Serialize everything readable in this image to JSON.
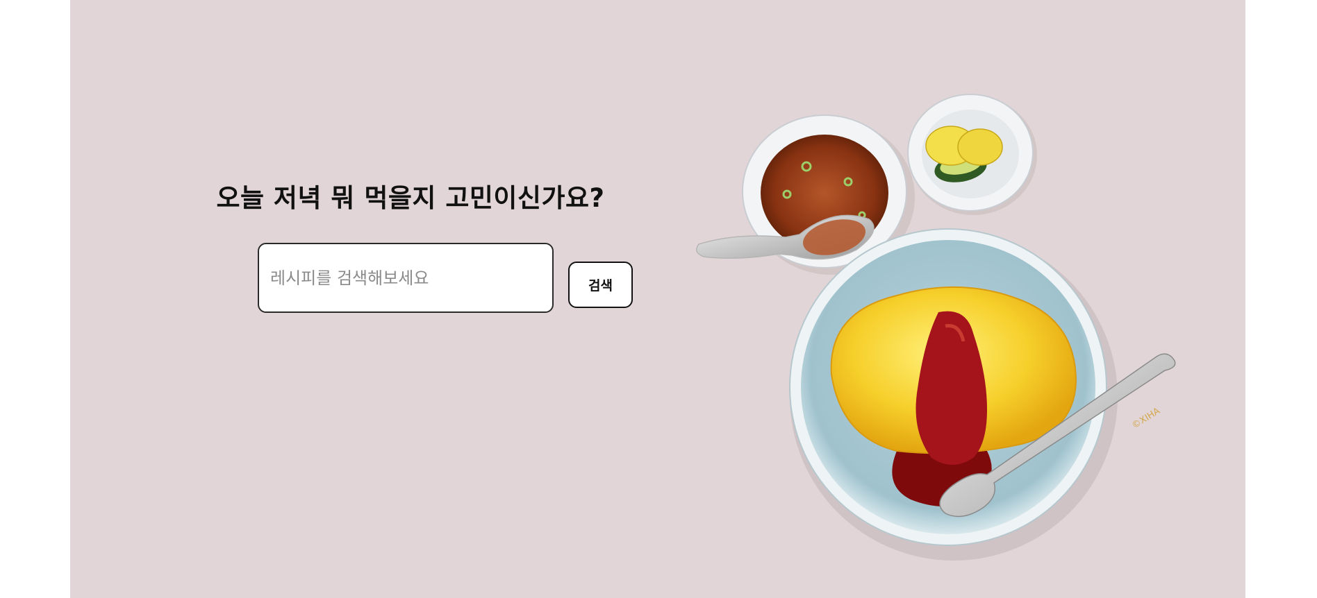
{
  "hero": {
    "headline": "오늘 저녁 뭐 먹을지 고민이신가요?",
    "background_color": "#e1d5d7"
  },
  "search": {
    "placeholder": "레시피를 검색해보세요",
    "value": "",
    "button_label": "검색"
  },
  "illustration": {
    "subject": "omurice-with-soup-and-pickles",
    "signature": "©XIHA"
  }
}
